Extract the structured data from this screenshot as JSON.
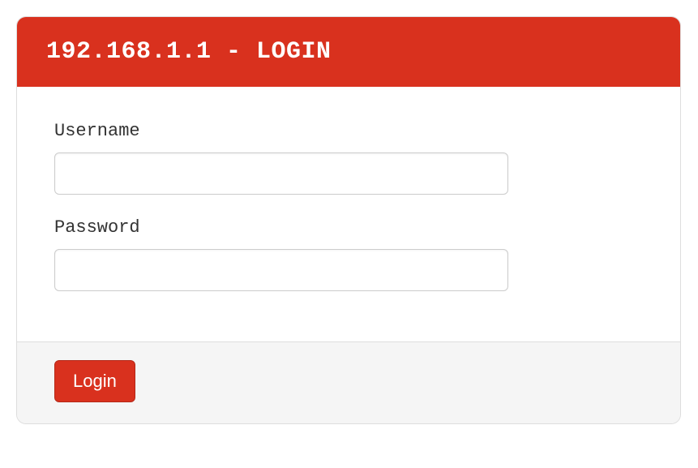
{
  "header": {
    "title": "192.168.1.1 - LOGIN"
  },
  "form": {
    "username": {
      "label": "Username",
      "value": ""
    },
    "password": {
      "label": "Password",
      "value": ""
    }
  },
  "footer": {
    "login_label": "Login"
  }
}
